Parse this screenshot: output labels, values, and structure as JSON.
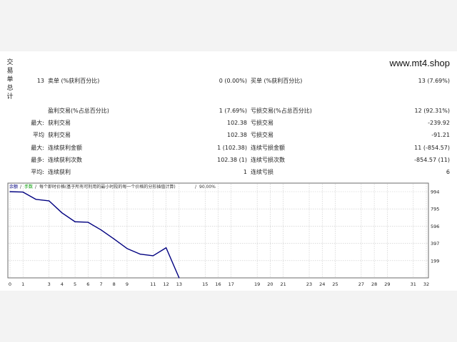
{
  "watermark": "www.mt4.shop",
  "side_title": [
    "交",
    "易",
    "单",
    "总",
    "计"
  ],
  "stats": {
    "row1": {
      "count": "13",
      "label": "卖单 (%获利百分比)",
      "value": "0 (0.00%)",
      "label2": "买单 (%获利百分比)",
      "value2": "13 (7.69%)"
    },
    "row2": {
      "label": "盈利交易(%占总百分比)",
      "value": "1 (7.69%)",
      "label2": "亏损交易(%占总百分比)",
      "value2": "12 (92.31%)"
    },
    "row3": {
      "prefix": "最大:",
      "label": "获利交易",
      "value": "102.38",
      "label2": "亏损交易",
      "value2": "-239.92"
    },
    "row4": {
      "prefix": "平均",
      "label": "获利交易",
      "value": "102.38",
      "label2": "亏损交易",
      "value2": "-91.21"
    },
    "row5": {
      "prefix": "最大:",
      "label": "连续获利金额",
      "value": "1 (102.38)",
      "label2": "连续亏损金额",
      "value2": "11 (-854.57)"
    },
    "row6": {
      "prefix": "最多:",
      "label": "连续获利次数",
      "value": "102.38 (1)",
      "label2": "连续亏损次数",
      "value2": "-854.57 (11)"
    },
    "row7": {
      "prefix": "平均:",
      "label": "连续获利",
      "value": "1",
      "label2": "连续亏损",
      "value2": "6"
    }
  },
  "chart_legend": {
    "balance": "余额",
    "lots": "手数",
    "description": "每个即时价格(基于所有可利用的最小时段的每一个价格的分形插值计算)",
    "quality": "90.00%"
  },
  "chart_data": {
    "type": "line",
    "x": [
      0,
      1,
      2,
      3,
      4,
      5,
      6,
      7,
      8,
      9,
      10,
      11,
      12,
      13
    ],
    "series": [
      {
        "values": [
          994,
          989,
          905,
          888,
          749,
          647,
          641,
          553,
          448,
          338,
          274,
          255,
          347,
          0
        ]
      }
    ],
    "xlim": [
      0,
      32
    ],
    "ylim": [
      0,
      994
    ],
    "x_ticks": [
      0,
      1,
      3,
      4,
      5,
      6,
      7,
      8,
      9,
      11,
      12,
      13,
      15,
      16,
      17,
      19,
      20,
      21,
      23,
      24,
      25,
      27,
      28,
      29,
      31,
      32
    ],
    "y_ticks": [
      994,
      795,
      596,
      397,
      199,
      0
    ],
    "grid": true,
    "line_color": "#000080"
  }
}
